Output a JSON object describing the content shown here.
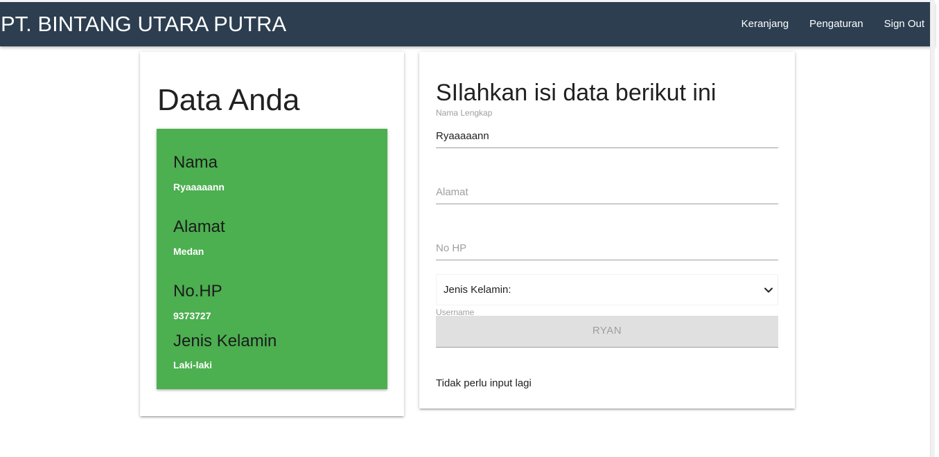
{
  "navbar": {
    "brand": "PT. BINTANG UTARA PUTRA",
    "links": [
      "Keranjang",
      "Pengaturan",
      "Sign Out"
    ],
    "background": "#2c3e50"
  },
  "data_card": {
    "title": "Data Anda",
    "box_color": "#4caf50",
    "fields": [
      {
        "label": "Nama",
        "value": "Ryaaaaann"
      },
      {
        "label": "Alamat",
        "value": "Medan"
      },
      {
        "label": "No.HP",
        "value": "9373727"
      },
      {
        "label": "Jenis Kelamin",
        "value": "Laki-laki"
      }
    ]
  },
  "form": {
    "title": "SIlahkan isi data berikut ini",
    "nama": {
      "label": "Nama Lengkap",
      "value": "Ryaaaaann"
    },
    "alamat": {
      "placeholder": "Alamat"
    },
    "nohp": {
      "placeholder": "No HP"
    },
    "jenis_kelamin": {
      "selected": "Jenis Kelamin:",
      "icon": "chevron-down-icon"
    },
    "username": {
      "label": "Username",
      "value": "RYAN"
    },
    "note": "Tidak perlu input lagi"
  }
}
